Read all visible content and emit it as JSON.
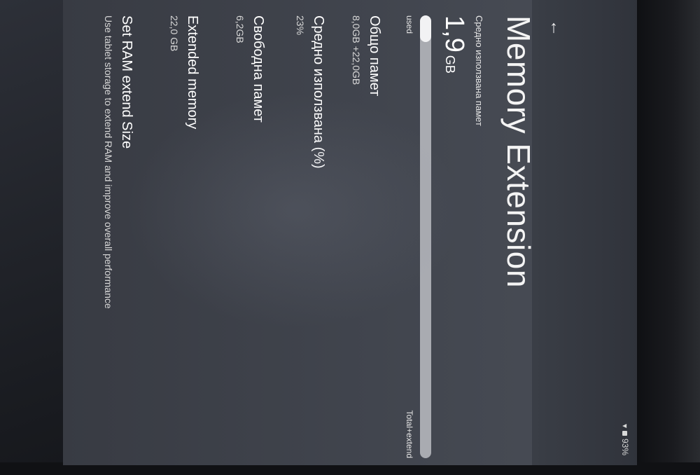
{
  "status_bar": {
    "battery": "93%"
  },
  "header": {
    "title": "Memory Extension"
  },
  "usage": {
    "avg_used_label": "Средно използвана памет",
    "value": "1,9",
    "unit": "GB",
    "used_fraction": 0.06,
    "used_label": "used",
    "total_label": "Total+extend"
  },
  "items": [
    {
      "title": "Общо памет",
      "value": "8,0GB +22,0GB"
    },
    {
      "title": "Средно използвана (%)",
      "value": "23%"
    },
    {
      "title": "Свободна памет",
      "value": "6,2GB"
    },
    {
      "title": "Extended memory",
      "value": "22,0 GB"
    },
    {
      "title": "Set RAM extend Size",
      "value": "Use tablet storage to extend RAM and improve overall performance"
    }
  ]
}
